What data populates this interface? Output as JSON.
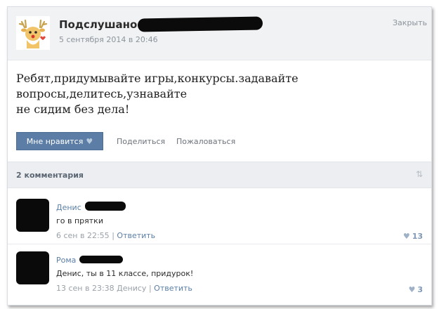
{
  "post": {
    "group_name": "Подслушано",
    "date": "5 сентября 2014 в 20:46",
    "close_label": "Закрыть",
    "text_lines": [
      "Ребят,придумывайте игры,конкурсы.задавайте",
      "вопросы,делитесь,узнавайте",
      "не сидим без дела!"
    ],
    "like_label": "Мне нравится",
    "share_label": "Поделиться",
    "report_label": "Пожаловаться"
  },
  "comments_header": {
    "count_label": "2 комментария",
    "sort_icon": "sort-arrows-icon"
  },
  "comments": [
    {
      "author": "Денис",
      "text": "го в прятки",
      "date": "6 сен в 22:55",
      "separator": "|",
      "reply_label": "Ответить",
      "likes": "13"
    },
    {
      "author": "Рома",
      "text": "Денис, ты в 11 классе, придурок!",
      "date": "13 сен в 23:38 Денису",
      "separator": "|",
      "reply_label": "Ответить",
      "likes": "3"
    }
  ],
  "colors": {
    "like_button_bg": "#5c7ea6",
    "link_blue": "#5b7fa6",
    "muted_gray": "#8d939b"
  },
  "icons": {
    "like_heart": "heart-icon",
    "group_avatar": "deer-mascot-icon"
  }
}
